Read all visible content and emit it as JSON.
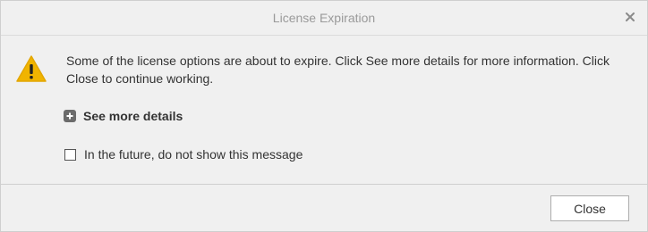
{
  "dialog": {
    "title": "License Expiration",
    "close_icon": "close-icon",
    "warning_icon": "warning-triangle-icon",
    "message": "Some of the license options are about to expire. Click See more details for more information. Click Close to continue working.",
    "details_icon": "plus-square-icon",
    "details_label": "See more details",
    "checkbox": {
      "label": "In the future, do not show this message",
      "checked": false
    },
    "close_button_label": "Close"
  },
  "colors": {
    "warning": "#f0b400",
    "title_text": "#9a9a9a",
    "background": "#f0f0f0"
  }
}
